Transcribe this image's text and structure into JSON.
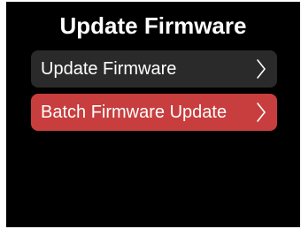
{
  "screen": {
    "title": "Update Firmware",
    "background": "#000000"
  },
  "menu": {
    "items": [
      {
        "label": "Update Firmware",
        "icon": "chevron-right-icon",
        "selected": false,
        "color": "#2a2a2a"
      },
      {
        "label": "Batch Firmware Update",
        "icon": "chevron-right-icon",
        "selected": true,
        "color": "#c83e3e"
      }
    ]
  }
}
